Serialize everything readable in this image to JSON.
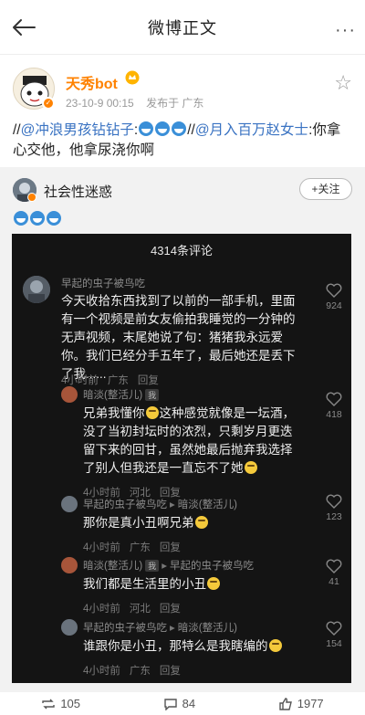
{
  "nav": {
    "title": "微博正文",
    "more": "···"
  },
  "post": {
    "username": "天秀bot",
    "time": "23-10-9 00:15",
    "source": "发布于 广东",
    "text_prefix": "//",
    "mention1": "@冲浪男孩钻钻子",
    "colon1": ":",
    "sep": "//",
    "mention2": "@月入百万赵女士",
    "text_tail": ":你拿心交他，他拿尿浇你啊"
  },
  "repost": {
    "name": "社会性迷惑",
    "follow_label": "+关注"
  },
  "screenshot": {
    "title": "4314条评论",
    "comments": [
      {
        "name": "早起的虫子被鸟吃",
        "text": "今天收拾东西找到了以前的一部手机，里面有一个视频是前女友偷拍我睡觉的一分钟的无声视频，末尾她说了句：猪猪我永远爱你。我们已经分手五年了，最后她还是丢下了我......",
        "time": "4小时前",
        "loc": "广东",
        "reply": "回复",
        "likes": "924"
      },
      {
        "name": "暗淡(整活儿)",
        "tag": "我",
        "text_a": "兄弟我懂你",
        "text_b": "这种感觉就像是一坛酒，没了当初封坛时的浓烈，只剩岁月更迭留下来的回甘，虽然她最后抛弃我选择了别人但我还是一直忘不了她",
        "time": "4小时前",
        "loc": "河北",
        "reply": "回复",
        "likes": "418"
      },
      {
        "name": "早起的虫子被鸟吃",
        "arrow": "▸",
        "to": "暗淡(整活儿)",
        "text": "那你是真小丑啊兄弟",
        "time": "4小时前",
        "loc": "广东",
        "reply": "回复",
        "likes": "123"
      },
      {
        "name": "暗淡(整活儿)",
        "tag": "我",
        "arrow": "▸",
        "to": "早起的虫子被鸟吃",
        "text": "我们都是生活里的小丑",
        "time": "4小时前",
        "loc": "河北",
        "reply": "回复",
        "likes": "41"
      },
      {
        "name": "早起的虫子被鸟吃",
        "arrow": "▸",
        "to": "暗淡(整活儿)",
        "text": "谁跟你是小丑，那特么是我瞎编的",
        "time": "4小时前",
        "loc": "广东",
        "reply": "回复",
        "likes": "154"
      }
    ]
  },
  "toolbar": {
    "reposts": "105",
    "comments": "84",
    "likes": "1977"
  },
  "colors": {
    "accent": "#ff8200",
    "link": "#3a73c2",
    "dark_bg": "#141414"
  }
}
